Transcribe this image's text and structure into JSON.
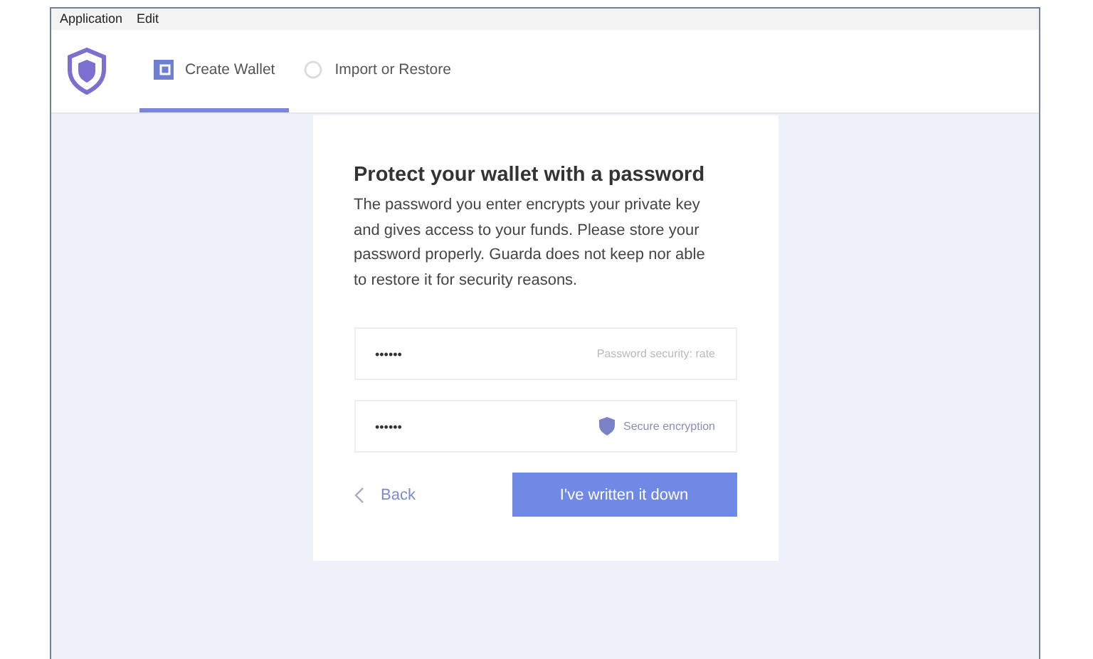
{
  "menu": [
    "Application",
    "Edit"
  ],
  "tabs": [
    {
      "label": "Create Wallet",
      "selected": true,
      "kind": "wallet"
    },
    {
      "label": "Import or Restore",
      "selected": false,
      "kind": "restore"
    }
  ],
  "card": {
    "title": "Protect your wallet with a password",
    "text": "The password you enter encrypts your private key and gives access to your funds. Please store your password properly. Guarda does not keep nor able to restore it for security reasons.",
    "fields": [
      {
        "value": "••••••",
        "hint": "Password security: rate",
        "kind": "rate"
      },
      {
        "value": "••••••",
        "hint": "Secure encryption",
        "kind": "secure"
      }
    ],
    "back": "Back",
    "confirm": "I've written it down"
  }
}
